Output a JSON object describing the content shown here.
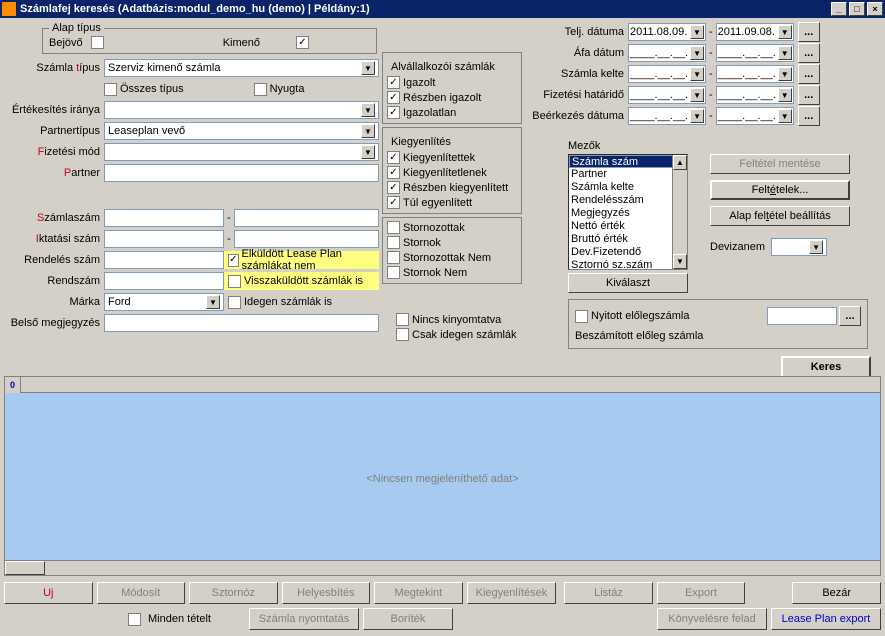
{
  "title": "Számlafej keresés   (Adatbázis:modul_demo_hu (demo) | Példány:1)",
  "alaptipus": {
    "legend": "Alap típus",
    "bejovo": "Bejövő",
    "kimeno": "Kimenő",
    "bejovo_val": false,
    "kimeno_val": true
  },
  "left": {
    "szamla_tipus": {
      "label": "Számla típus",
      "value": "Szerviz kimenő számla",
      "hot": "t"
    },
    "osszes": "Összes típus",
    "osszes_val": false,
    "nyugta": "Nyugta",
    "nyugta_val": false,
    "ertekesites": {
      "label": "Értékesítés iránya"
    },
    "partnertipus": {
      "label": "Partnertípus",
      "value": "Leaseplan vevő"
    },
    "fizmod": {
      "label": "Fizetési mód",
      "hot": "F"
    },
    "partner": {
      "label": "Partner",
      "hot": "P"
    },
    "szamlaszam": {
      "label": "Számlaszám",
      "hot": "S"
    },
    "iktatasi": {
      "label": "Iktatási szám",
      "hot": "I"
    },
    "rendeles": {
      "label": "Rendelés szám"
    },
    "rendszam": {
      "label": "Rendszám"
    },
    "marka": {
      "label": "Márka",
      "value": "Ford"
    },
    "belso": {
      "label": "Belső megjegyzés"
    },
    "elk": "Elküldött Lease Plan számlákat nem",
    "elk_val": true,
    "vissza": "Visszaküldött számlák is",
    "vissza_val": false,
    "idegen": "Idegen számlák is",
    "idegen_val": false,
    "nincs": "Nincs kinyomtatva",
    "nincs_val": false,
    "csak": "Csak idegen számlák",
    "csak_val": false
  },
  "col2": {
    "alvall": {
      "title": "Alvállalkozói számlák",
      "igazolt": "Igazolt",
      "reszben": "Részben igazolt",
      "igazolatlan": "Igazolatlan",
      "v": [
        true,
        true,
        true
      ]
    },
    "kiegy": {
      "title": "Kiegyenlítés",
      "k1": "Kiegyenlítettek",
      "k2": "Kiegyenlítetlenek",
      "k3": "Részben kiegyenlített",
      "k4": "Túl egyenlített",
      "v": [
        true,
        true,
        true,
        true
      ]
    },
    "storno": {
      "s1": "Stornozottak",
      "s2": "Stornok",
      "s3": "Stornozottak Nem",
      "s4": "Stornok Nem",
      "v": [
        false,
        false,
        false,
        false
      ]
    }
  },
  "dates": {
    "telj": {
      "label": "Telj. dátuma",
      "hot": "d",
      "from": "2011.08.09.",
      "to": "2011.09.08."
    },
    "afa": {
      "label": "Áfa dátum",
      "hot": "Á",
      "from": "____.__.__.",
      "to": "____.__.__."
    },
    "kelte": {
      "label": "Számla kelte",
      "hot": "k",
      "from": "____.__.__.",
      "to": "____.__.__."
    },
    "fiz": {
      "label": "Fizetési határidő",
      "hot": "z",
      "from": "____.__.__.",
      "to": "____.__.__."
    },
    "beerk": {
      "label": "Beérkezés dátuma",
      "from": "____.__.__.",
      "to": "____.__.__."
    }
  },
  "mezok": {
    "label": "Mezők",
    "items": [
      "Számla szám",
      "Partner",
      "Számla kelte",
      "Rendelésszám",
      "Megjegyzés",
      "Nettó érték",
      "Bruttó érték",
      "Dev.Fizetendő",
      "Sztornó sz.szám"
    ]
  },
  "right_btns": {
    "mentes": "Feltétel mentése",
    "feltetelek": "Feltételek...",
    "hot_feltetelek": "é",
    "alap": "Alap feltétel beállítás",
    "hot_alap": "t",
    "devizanem": "Devizanem",
    "kivalaszt": "Kiválaszt"
  },
  "nyitott": {
    "label": "Nyitott előlegszámla",
    "val": false
  },
  "beszamitott": "Beszámított előleg számla",
  "keres": "Keres",
  "results": {
    "corner": "0",
    "empty": "<Nincsen megjeleníthető adat>"
  },
  "toolbar": {
    "uj": "Uj",
    "modosit": "Módosít",
    "sztornoz": "Sztornóz",
    "helyesbites": "Helyesbítés",
    "megtekint": "Megtekint",
    "kiegy": "Kiegyenlítések",
    "minden": "Minden tételt",
    "minden_val": false,
    "nyomtat": "Számla nyomtatás",
    "boritek": "Boríték",
    "listaz": "Listáz",
    "export": "Export",
    "bezar": "Bezár",
    "konyv": "Könyvelésre felad",
    "lease": "Lease Plan export"
  }
}
